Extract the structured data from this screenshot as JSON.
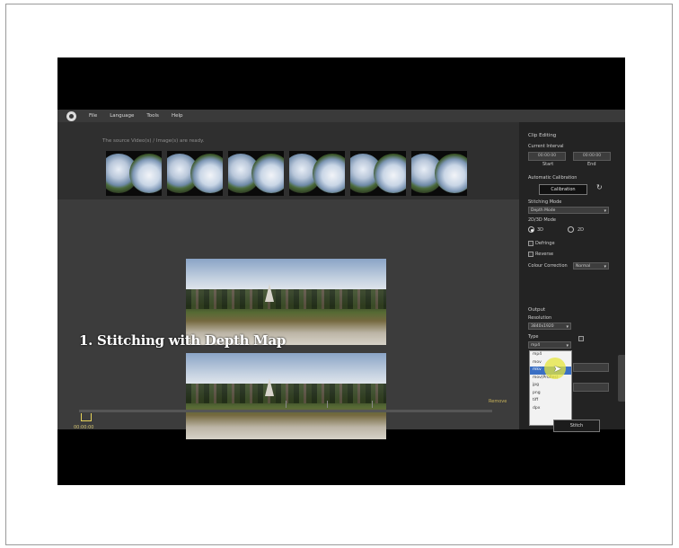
{
  "menu": {
    "items": [
      "File",
      "Language",
      "Tools",
      "Help"
    ]
  },
  "status": {
    "message": "The source Video(s) / Image(s) are ready."
  },
  "thumbnails": {
    "count": 6
  },
  "caption": {
    "text": "1. Stitching with Depth Map"
  },
  "timeline": {
    "timecode": "00:00:00",
    "remove_label": "Remove"
  },
  "panel": {
    "clip_editing": "Clip Editing",
    "current_interval": "Current Interval",
    "start_time": "00:00:00",
    "end_time": "00:00:00",
    "start_label": "Start",
    "end_label": "End",
    "auto_calibration": "Automatic Calibration",
    "calibration_button": "Calibration",
    "stitching_mode_label": "Stitching Mode",
    "stitching_mode_value": "Depth Mode",
    "dim_mode_label": "2D/3D Mode",
    "mode_3d": "3D",
    "mode_2d": "2D",
    "defringe": "Defringe",
    "reverse": "Reverse",
    "colour_correction_label": "Colour Correction",
    "colour_correction_value": "Normal",
    "output": "Output",
    "resolution_label": "Resolution",
    "resolution_value": "3840x1920",
    "type_label": "Type",
    "type_value": "mp4",
    "type_options": [
      "mp4",
      "mov",
      "mkv",
      "mov(ProRes)",
      "jpg",
      "png",
      "tiff",
      "dpx"
    ],
    "type_selected_index": 2,
    "stitch_button": "Stitch"
  },
  "colors": {
    "background": "#000000",
    "panel": "#232323",
    "selection": "#3a6fc4",
    "highlight": "#e6e63c"
  }
}
